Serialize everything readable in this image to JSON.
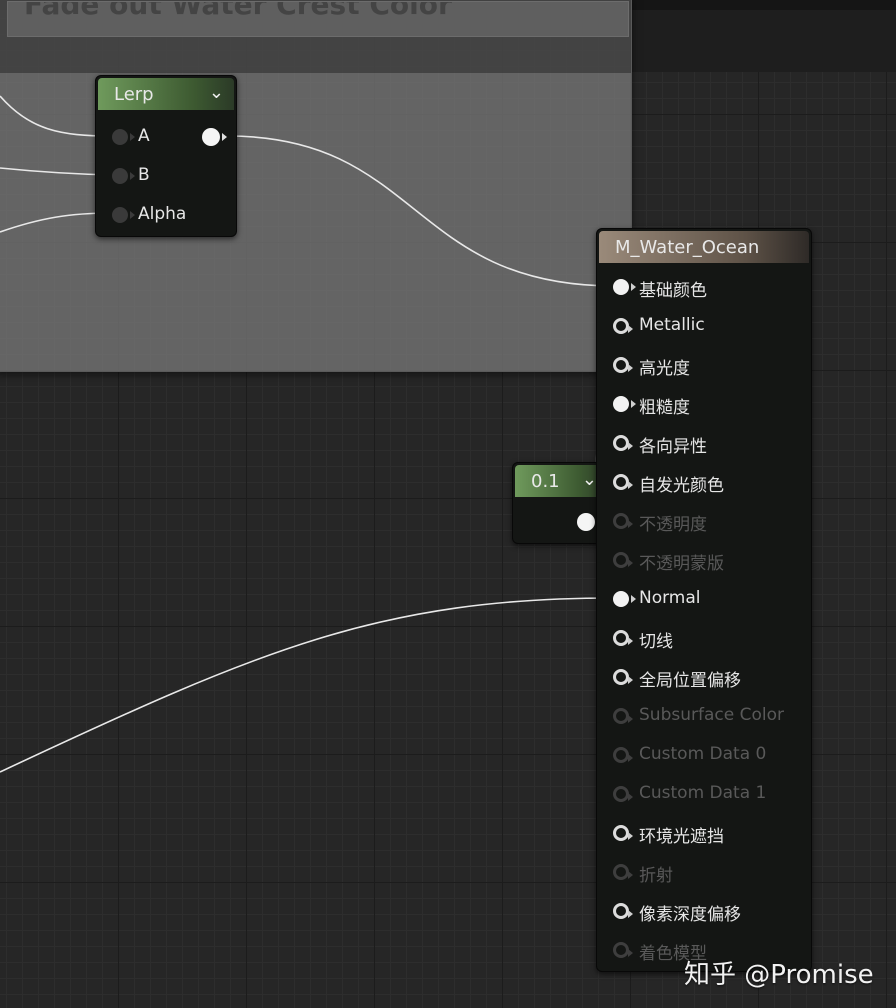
{
  "comment": {
    "title": "Fade out Water Crest Color"
  },
  "lerp_node": {
    "title": "Lerp",
    "inputs": [
      "A",
      "B",
      "Alpha"
    ]
  },
  "constant_node": {
    "title": "0.1"
  },
  "material_node": {
    "title": "M_Water_Ocean",
    "inputs": [
      {
        "label": "基础颜色",
        "state": "connected"
      },
      {
        "label": "Metallic",
        "state": "enabled"
      },
      {
        "label": "高光度",
        "state": "enabled"
      },
      {
        "label": "粗糙度",
        "state": "connected"
      },
      {
        "label": "各向异性",
        "state": "enabled"
      },
      {
        "label": "自发光颜色",
        "state": "enabled"
      },
      {
        "label": "不透明度",
        "state": "disabled"
      },
      {
        "label": "不透明蒙版",
        "state": "disabled"
      },
      {
        "label": "Normal",
        "state": "connected"
      },
      {
        "label": "切线",
        "state": "enabled"
      },
      {
        "label": "全局位置偏移",
        "state": "enabled"
      },
      {
        "label": "Subsurface Color",
        "state": "disabled"
      },
      {
        "label": "Custom Data 0",
        "state": "disabled"
      },
      {
        "label": "Custom Data 1",
        "state": "disabled"
      },
      {
        "label": "环境光遮挡",
        "state": "enabled"
      },
      {
        "label": "折射",
        "state": "disabled"
      },
      {
        "label": "像素深度偏移",
        "state": "enabled"
      },
      {
        "label": "着色模型",
        "state": "disabled"
      }
    ]
  },
  "watermark": "知乎 @Promise",
  "colors": {
    "background": "#262626",
    "wire": "#e8e8e8",
    "lerp_header": "#6f9a5c",
    "material_header": "#9a8a7a"
  }
}
